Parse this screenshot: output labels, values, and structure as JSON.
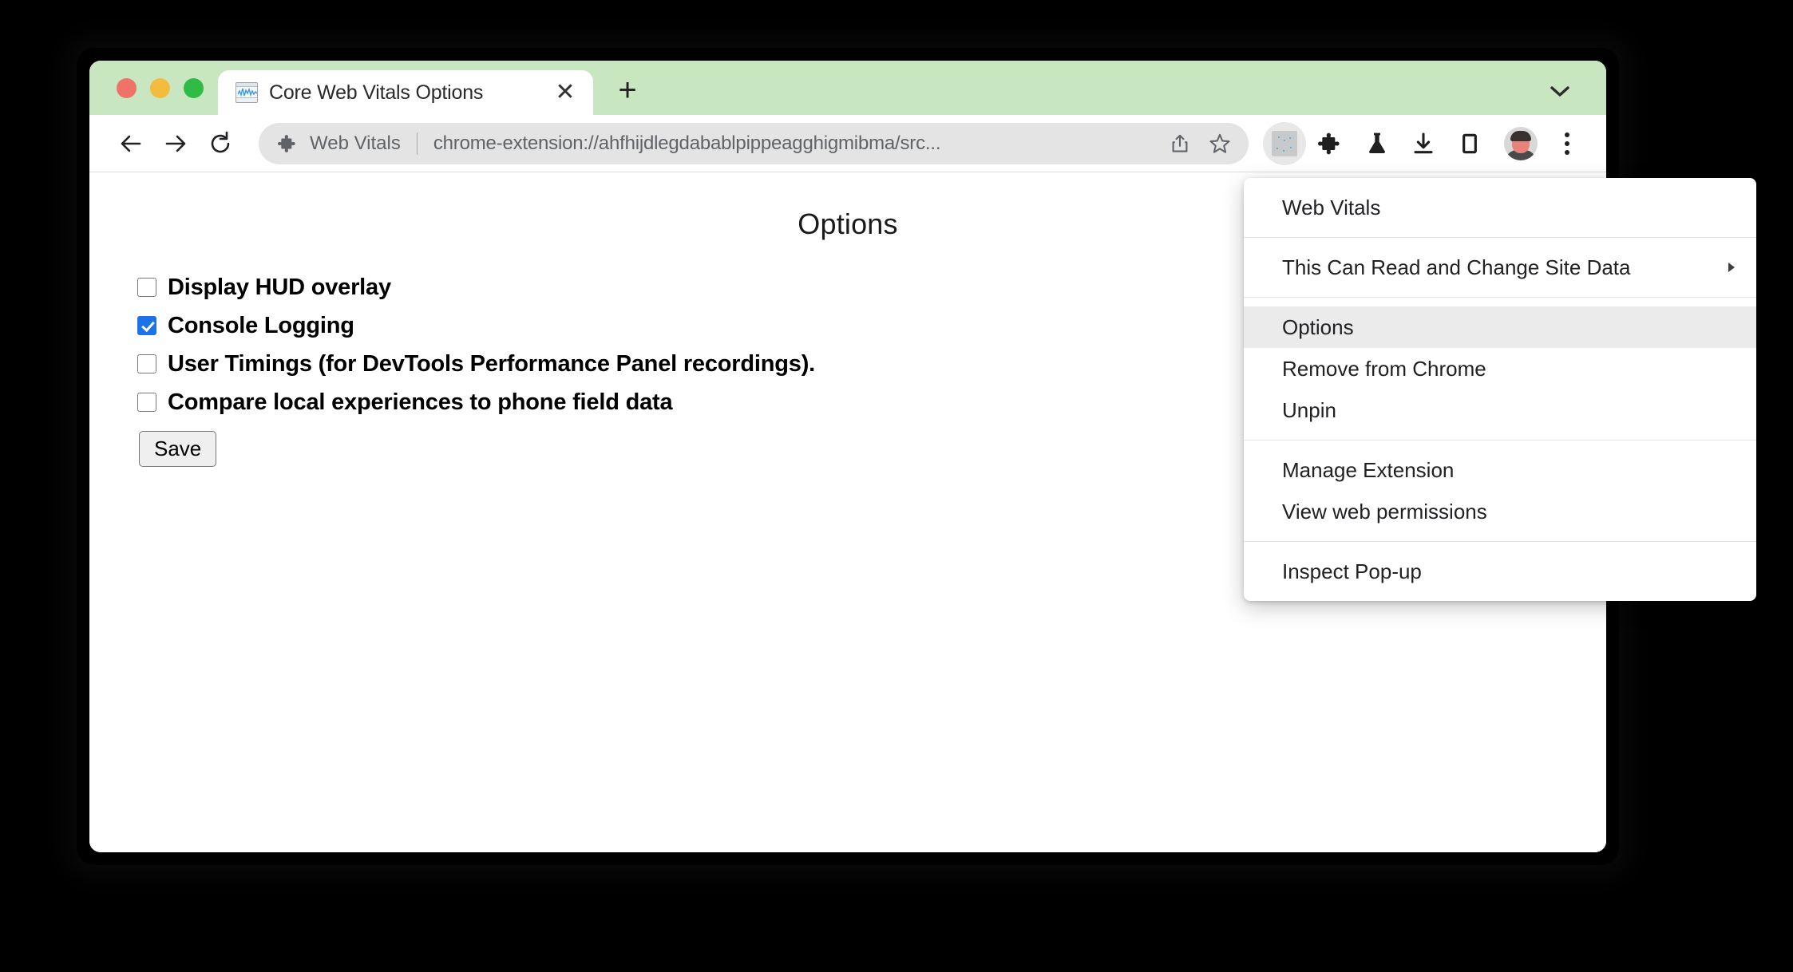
{
  "window": {
    "traffic_lights": [
      "close",
      "minimize",
      "maximize"
    ]
  },
  "tab_strip": {
    "tab": {
      "title": "Core Web Vitals Options",
      "favicon": "web-vitals-chart-icon",
      "close_label": "✕"
    },
    "new_tab_label": "+",
    "tab_list_icon": "chevron-down-icon"
  },
  "toolbar": {
    "back_icon": "arrow-left-icon",
    "forward_icon": "arrow-right-icon",
    "reload_icon": "reload-icon",
    "omnibox": {
      "extension_icon": "puzzle-piece-icon",
      "extension_label": "Web Vitals",
      "url": "chrome-extension://ahfhijdlegdabablpippeagghigmibma/src...",
      "share_icon": "share-icon",
      "bookmark_icon": "star-icon"
    },
    "actions": [
      {
        "name": "web-vitals-extension-action",
        "icon": "extension-square-icon"
      },
      {
        "name": "extensions-button",
        "icon": "puzzle-piece-icon"
      },
      {
        "name": "experiments-button",
        "icon": "flask-icon"
      },
      {
        "name": "downloads-button",
        "icon": "download-icon"
      },
      {
        "name": "side-panel-button",
        "icon": "side-panel-icon"
      }
    ],
    "avatar_label": "profile-avatar",
    "menu_icon": "three-dot-menu-icon"
  },
  "page": {
    "title": "Options",
    "options": [
      {
        "label": "Display HUD overlay",
        "checked": false
      },
      {
        "label": "Console Logging",
        "checked": true
      },
      {
        "label": "User Timings (for DevTools Performance Panel recordings).",
        "checked": false
      },
      {
        "label": "Compare local experiences to phone field data",
        "checked": false
      }
    ],
    "save_label": "Save"
  },
  "extension_menu": {
    "groups": [
      {
        "items": [
          {
            "label": "Web Vitals",
            "highlighted": false,
            "submenu": false
          }
        ]
      },
      {
        "items": [
          {
            "label": "This Can Read and Change Site Data",
            "highlighted": false,
            "submenu": true
          }
        ]
      },
      {
        "items": [
          {
            "label": "Options",
            "highlighted": true,
            "submenu": false
          },
          {
            "label": "Remove from Chrome",
            "highlighted": false,
            "submenu": false
          },
          {
            "label": "Unpin",
            "highlighted": false,
            "submenu": false
          }
        ]
      },
      {
        "items": [
          {
            "label": "Manage Extension",
            "highlighted": false,
            "submenu": false
          },
          {
            "label": "View web permissions",
            "highlighted": false,
            "submenu": false
          }
        ]
      },
      {
        "items": [
          {
            "label": "Inspect Pop-up",
            "highlighted": false,
            "submenu": false
          }
        ]
      }
    ]
  },
  "colors": {
    "tab_strip_bg": "#c8e6c0",
    "accent_checkbox": "#1a73e8",
    "omnibox_bg": "#e4e4e4",
    "menu_highlight": "#ebebeb",
    "desktop_bg": "#000000"
  }
}
